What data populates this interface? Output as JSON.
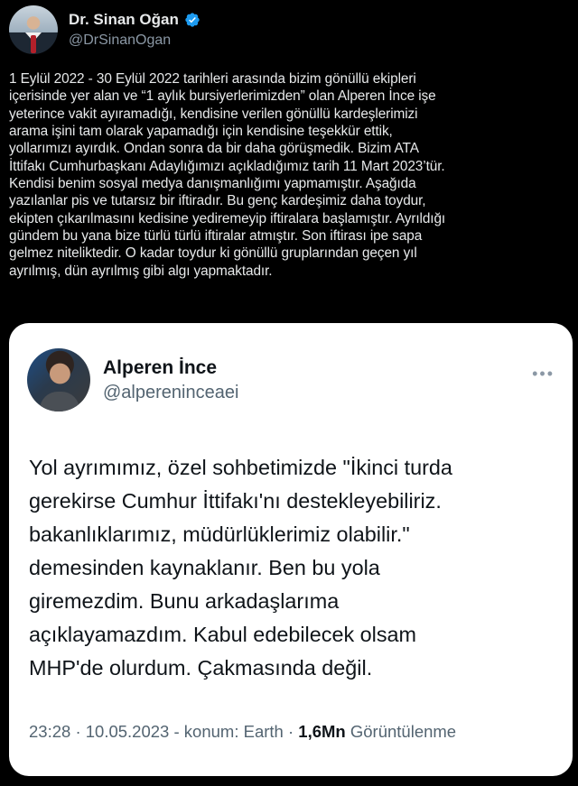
{
  "author": {
    "display_name": "Dr. Sinan Oğan",
    "handle": "@DrSinanOgan",
    "verified_icon": "verified-badge-icon",
    "verified_color": "#1d9bf0"
  },
  "tweet": {
    "text": "1 Eylül 2022 - 30 Eylül 2022 tarihleri arasında bizim gönüllü ekipleri\niçerisinde yer alan ve “1 aylık bursiyerlerimizden” olan Alperen İnce işe\nyeterince vakit ayıramadığı, kendisine verilen gönüllü kardeşlerimizi\narama işini tam olarak yapamadığı için kendisine teşekkür ettik,\nyollarımızı ayırdık. Ondan sonra da bir daha görüşmedik. Bizim ATA\nİttifakı Cumhurbaşkanı Adaylığımızı açıkladığımız tarih 11 Mart 2023’tür.\nKendisi benim sosyal medya danışmanlığımı yapmamıştır. Aşağıda\nyazılanlar pis ve tutarsız bir iftiradır. Bu genç kardeşimiz daha toydur,\nekipten çıkarılmasını kedisine yediremeyip iftiralara başlamıştır. Ayrıldığı\ngündem bu yana bize türlü türlü iftiralar atmıştır. Son iftirası ipe sapa\ngelmez niteliktedir. O kadar toydur ki gönüllü gruplarından geçen yıl\nayrılmış, dün ayrılmış gibi algı yapmaktadır."
  },
  "quoted_tweet": {
    "display_name": "Alperen İnce",
    "handle": "@alpereninceaei",
    "more_icon": "more-options-icon",
    "text": "Yol ayrımımız, özel sohbetimizde \"İkinci turda\ngerekirse Cumhur İttifakı'nı destekleyebiliriz.\nbakanlıklarımız, müdürlüklerimiz olabilir.\"\ndemesinden kaynaklanır. Ben bu yola\ngiremezdim. Bunu arkadaşlarıma\naçıklayamazdım. Kabul edebilecek olsam\nMHP'de olurdum. Çakmasında değil.",
    "time": "23:28",
    "date": "10.05.2023",
    "location": "konum: Earth",
    "views_count": "1,6Mn",
    "views_label": "Görüntülenme"
  }
}
